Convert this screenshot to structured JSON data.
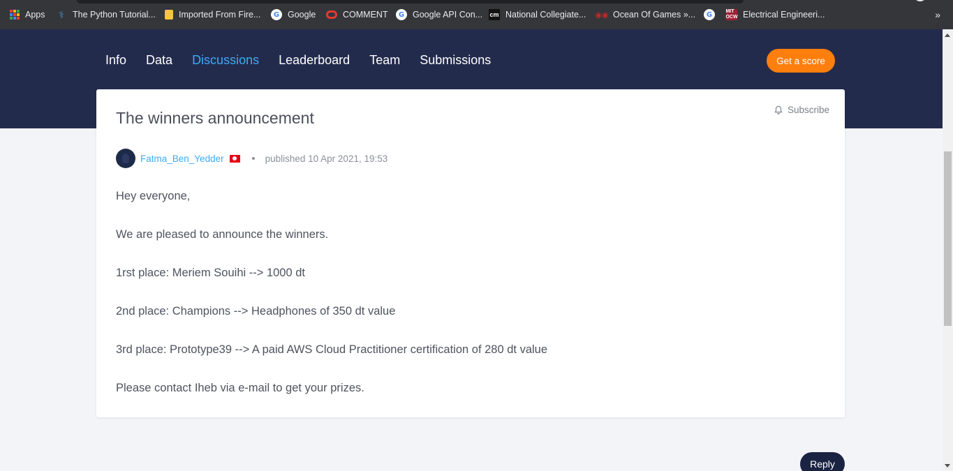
{
  "bookmarks": {
    "items": [
      {
        "label": "Apps",
        "icon": "apps-grid-icon"
      },
      {
        "label": "The Python Tutorial...",
        "icon": "python-icon"
      },
      {
        "label": "Imported From Fire...",
        "icon": "folder-icon"
      },
      {
        "label": "Google",
        "icon": "google-icon"
      },
      {
        "label": "COMMENT",
        "icon": "oracle-icon"
      },
      {
        "label": "Google API Con...",
        "icon": "google-icon"
      },
      {
        "label": "National Collegiate...",
        "icon": "cm-icon"
      },
      {
        "label": "Ocean Of Games »...",
        "icon": "ocean-of-games-icon"
      },
      {
        "label": "",
        "icon": "google-icon"
      },
      {
        "label": "Electrical Engineeri...",
        "icon": "mit-ocw-icon"
      }
    ],
    "more": "»"
  },
  "nav": {
    "items": [
      {
        "label": "Info",
        "active": false
      },
      {
        "label": "Data",
        "active": false
      },
      {
        "label": "Discussions",
        "active": true
      },
      {
        "label": "Leaderboard",
        "active": false
      },
      {
        "label": "Team",
        "active": false
      },
      {
        "label": "Submissions",
        "active": false
      }
    ],
    "score_button": "Get a score"
  },
  "post": {
    "title": "The winners announcement",
    "subscribe": "Subscribe",
    "author": "Fatma_Ben_Yedder",
    "published": "published 10 Apr 2021, 19:53",
    "paragraphs": [
      "Hey everyone,",
      "We are pleased to announce the winners.",
      "1rst place: Meriem Souihi --> 1000 dt",
      "2nd place: Champions --> Headphones of 350 dt value",
      "3rd place: Prototype39 --> A paid AWS Cloud Practitioner certification of 280 dt value",
      "Please contact Iheb via e-mail to get your prizes."
    ]
  },
  "reply_button": "Reply",
  "colors": {
    "header_bg": "#232b4d",
    "accent": "#3fa9f5",
    "score_button": "#ff7f0e",
    "reply_button": "#1a2342"
  }
}
